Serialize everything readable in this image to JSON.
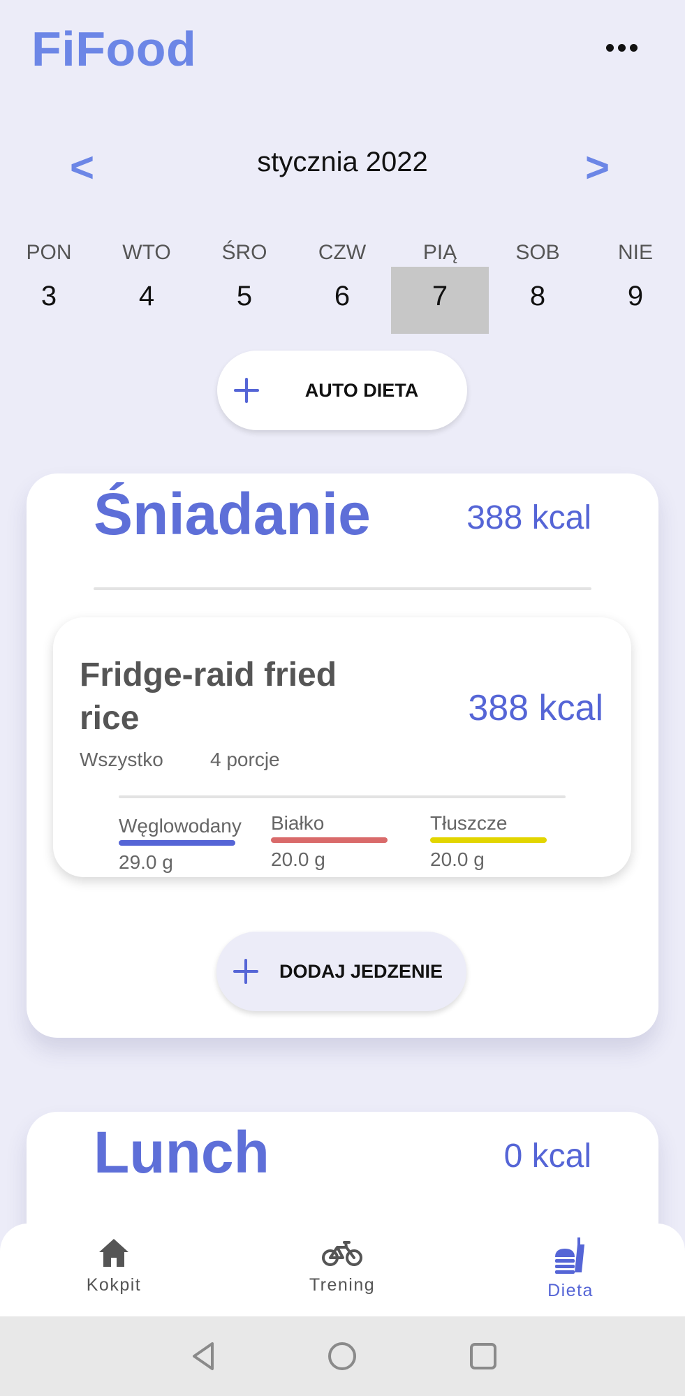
{
  "app": {
    "title": "FiFood",
    "more_icon": "more-horizontal-icon"
  },
  "calendar": {
    "prev_label": "<",
    "next_label": ">",
    "month_label": "stycznia 2022",
    "days": [
      {
        "name": "PON",
        "num": "3"
      },
      {
        "name": "WTO",
        "num": "4"
      },
      {
        "name": "ŚRO",
        "num": "5"
      },
      {
        "name": "CZW",
        "num": "6"
      },
      {
        "name": "PIĄ",
        "num": "7",
        "selected": true
      },
      {
        "name": "SOB",
        "num": "8"
      },
      {
        "name": "NIE",
        "num": "9"
      }
    ]
  },
  "auto_diet": {
    "label": "AUTO DIETA"
  },
  "meals": {
    "breakfast": {
      "title": "Śniadanie",
      "kcal": "388 kcal",
      "foods": [
        {
          "name": "Fridge-raid fried rice",
          "kcal": "388 kcal",
          "category": "Wszystko",
          "portions": "4 porcje",
          "macros": {
            "carbs": {
              "label": "Węglowodany",
              "value": "29.0 g",
              "color": "#5565D6"
            },
            "protein": {
              "label": "Białko",
              "value": "20.0 g",
              "color": "#D96A6A"
            },
            "fat": {
              "label": "Tłuszcze",
              "value": "20.0 g",
              "color": "#E2D500"
            }
          }
        }
      ],
      "add_label": "DODAJ JEDZENIE"
    },
    "lunch": {
      "title": "Lunch",
      "kcal": "0 kcal"
    }
  },
  "bottom_nav": {
    "items": [
      {
        "label": "Kokpit",
        "icon": "home-icon"
      },
      {
        "label": "Trening",
        "icon": "bicycle-icon"
      },
      {
        "label": "Dieta",
        "icon": "food-icon",
        "active": true
      }
    ]
  },
  "colors": {
    "accent": "#6C86E6",
    "primary": "#5565D6",
    "background": "#ECECF8"
  }
}
